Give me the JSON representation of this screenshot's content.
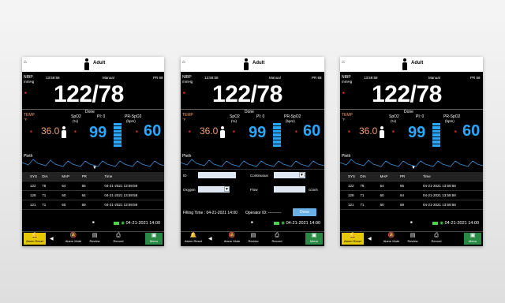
{
  "header": {
    "patient_type": "Adult"
  },
  "monitor": {
    "nibp_label": "NIBP",
    "nibp_unit": "mmHg",
    "time": "13:59:58",
    "mode": "Manual",
    "pr_label": "PR 68",
    "bp_value": "122/78",
    "temp_label": "TEMP",
    "temp_unit": "°F",
    "temp_value": "36.0",
    "spo2_label": "SpO2",
    "spo2_unit": "(%)",
    "spo2_value": "99",
    "pi_label": "PI: 0",
    "done_label": "Done",
    "prspo2_label": "PR-SpO2",
    "prspo2_unit": "(bpm)",
    "pr_value": "60",
    "pleth_label": "Pleth",
    "waveform_color": "#3a8fd8"
  },
  "table": {
    "headers": [
      "SYS",
      "DIA",
      "MAP",
      "PR",
      "Time"
    ],
    "rows": [
      [
        "122",
        "78",
        "64",
        "65",
        "04-21-2021 13:59:58"
      ],
      [
        "128",
        "71",
        "60",
        "64",
        "04-21-2021 13:59:58"
      ],
      [
        "121",
        "71",
        "60",
        "69",
        "04-21-2021 13:59:58"
      ]
    ]
  },
  "status": {
    "date": "04-21-2021",
    "time": "14:00"
  },
  "bottom": {
    "alarm_reset": "Alarm Reset",
    "alarm_mute": "Alarm Mute",
    "review": "Review",
    "record": "Record",
    "menu": "Menu"
  },
  "form": {
    "id_label": "ID",
    "mode_label": "Continuous",
    "oxygen_label": "Oxygen",
    "flow_label": "Flow",
    "flow_unit": "ccm/s",
    "filing_time_label": "Filling Time : 04-21-2021 14:00",
    "operator_label": "Operator ID: ----------",
    "done_button": "Done"
  },
  "colors": {
    "accent_blue": "#2aa8ff",
    "temp_orange": "#f0a070",
    "alarm_yellow": "#e6c900",
    "menu_green": "#2a8a45"
  }
}
